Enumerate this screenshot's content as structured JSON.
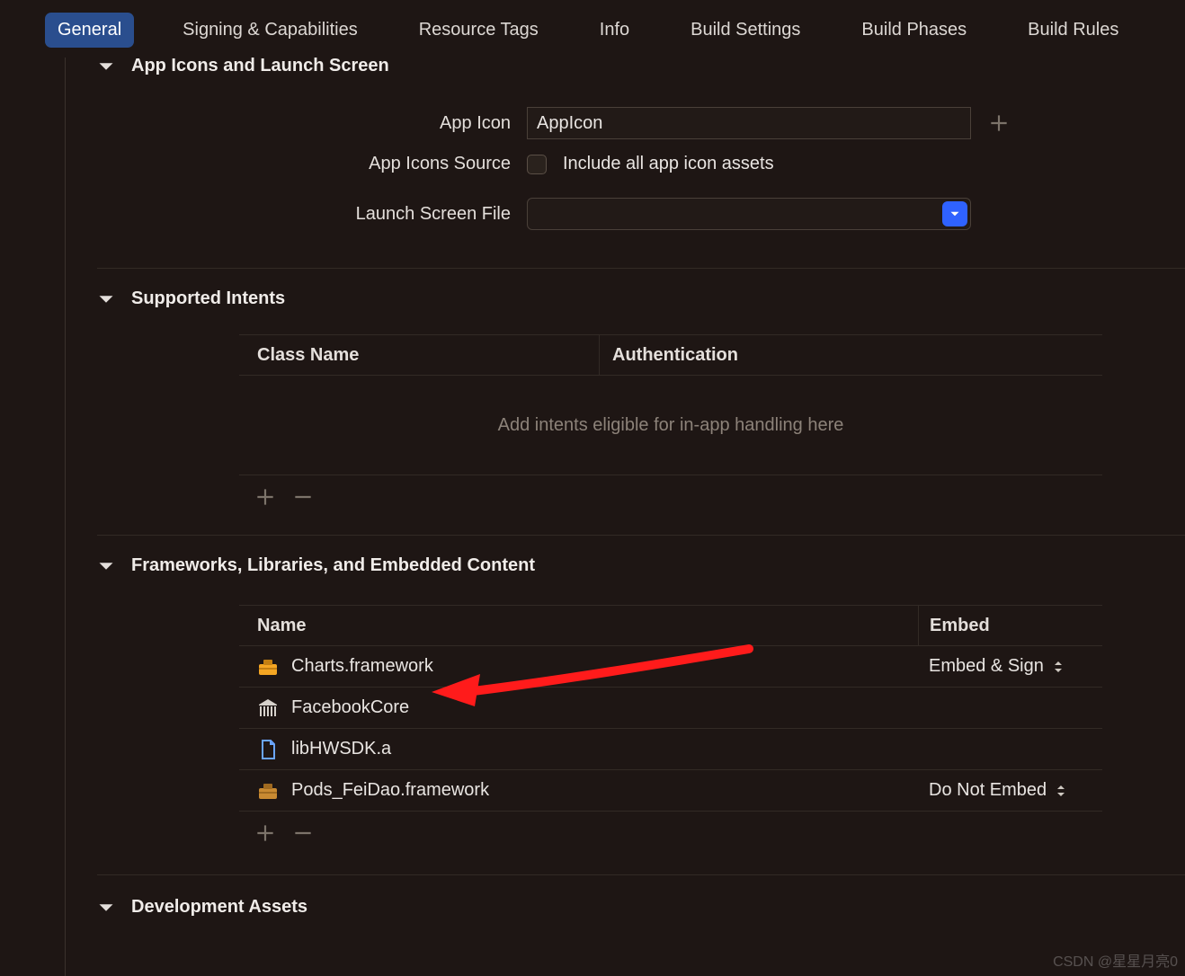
{
  "tabs": {
    "items": [
      {
        "label": "General",
        "selected": true
      },
      {
        "label": "Signing & Capabilities"
      },
      {
        "label": "Resource Tags"
      },
      {
        "label": "Info"
      },
      {
        "label": "Build Settings"
      },
      {
        "label": "Build Phases"
      },
      {
        "label": "Build Rules"
      }
    ]
  },
  "sections": {
    "app_icons": {
      "title": "App Icons and Launch Screen",
      "app_icon_label": "App Icon",
      "app_icon_value": "AppIcon",
      "source_label": "App Icons Source",
      "source_checkbox_label": "Include all app icon assets",
      "launch_label": "Launch Screen File",
      "launch_value": ""
    },
    "intents": {
      "title": "Supported Intents",
      "columns": {
        "class": "Class Name",
        "auth": "Authentication"
      },
      "placeholder": "Add intents eligible for in-app handling here"
    },
    "frameworks": {
      "title": "Frameworks, Libraries, and Embedded Content",
      "columns": {
        "name": "Name",
        "embed": "Embed"
      },
      "rows": [
        {
          "icon": "toolbox",
          "icon_color": "#f5a623",
          "name": "Charts.framework",
          "embed": "Embed & Sign"
        },
        {
          "icon": "library",
          "icon_color": "#d6d1cb",
          "name": "FacebookCore",
          "embed": ""
        },
        {
          "icon": "file",
          "icon_color": "#6aa5ff",
          "name": "libHWSDK.a",
          "embed": ""
        },
        {
          "icon": "toolbox",
          "icon_color": "#c98a32",
          "name": "Pods_FeiDao.framework",
          "embed": "Do Not Embed"
        }
      ]
    },
    "dev_assets": {
      "title": "Development Assets"
    }
  },
  "watermark": "CSDN @星星月亮0"
}
